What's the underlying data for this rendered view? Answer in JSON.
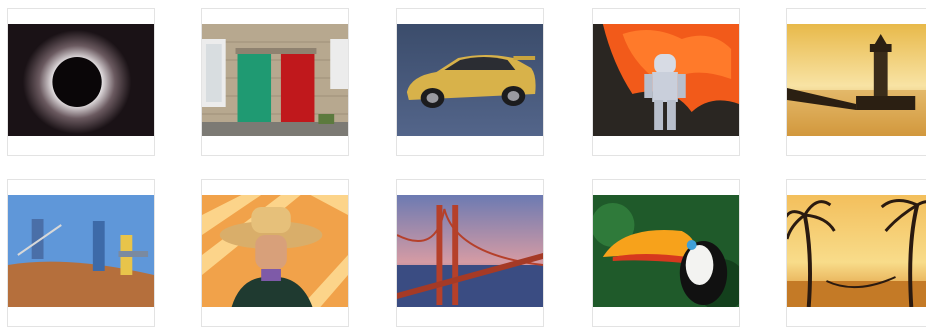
{
  "gallery": {
    "items": [
      {
        "subject": "solar-eclipse"
      },
      {
        "subject": "green-and-red-doors"
      },
      {
        "subject": "yellow-sports-car"
      },
      {
        "subject": "astronaut-in-lava"
      },
      {
        "subject": "lighthouse-at-sunset"
      },
      {
        "subject": "hikers-on-dune"
      },
      {
        "subject": "cowboy-portrait"
      },
      {
        "subject": "golden-gate-bridge"
      },
      {
        "subject": "toucan"
      },
      {
        "subject": "palm-trees-hammock"
      }
    ]
  }
}
